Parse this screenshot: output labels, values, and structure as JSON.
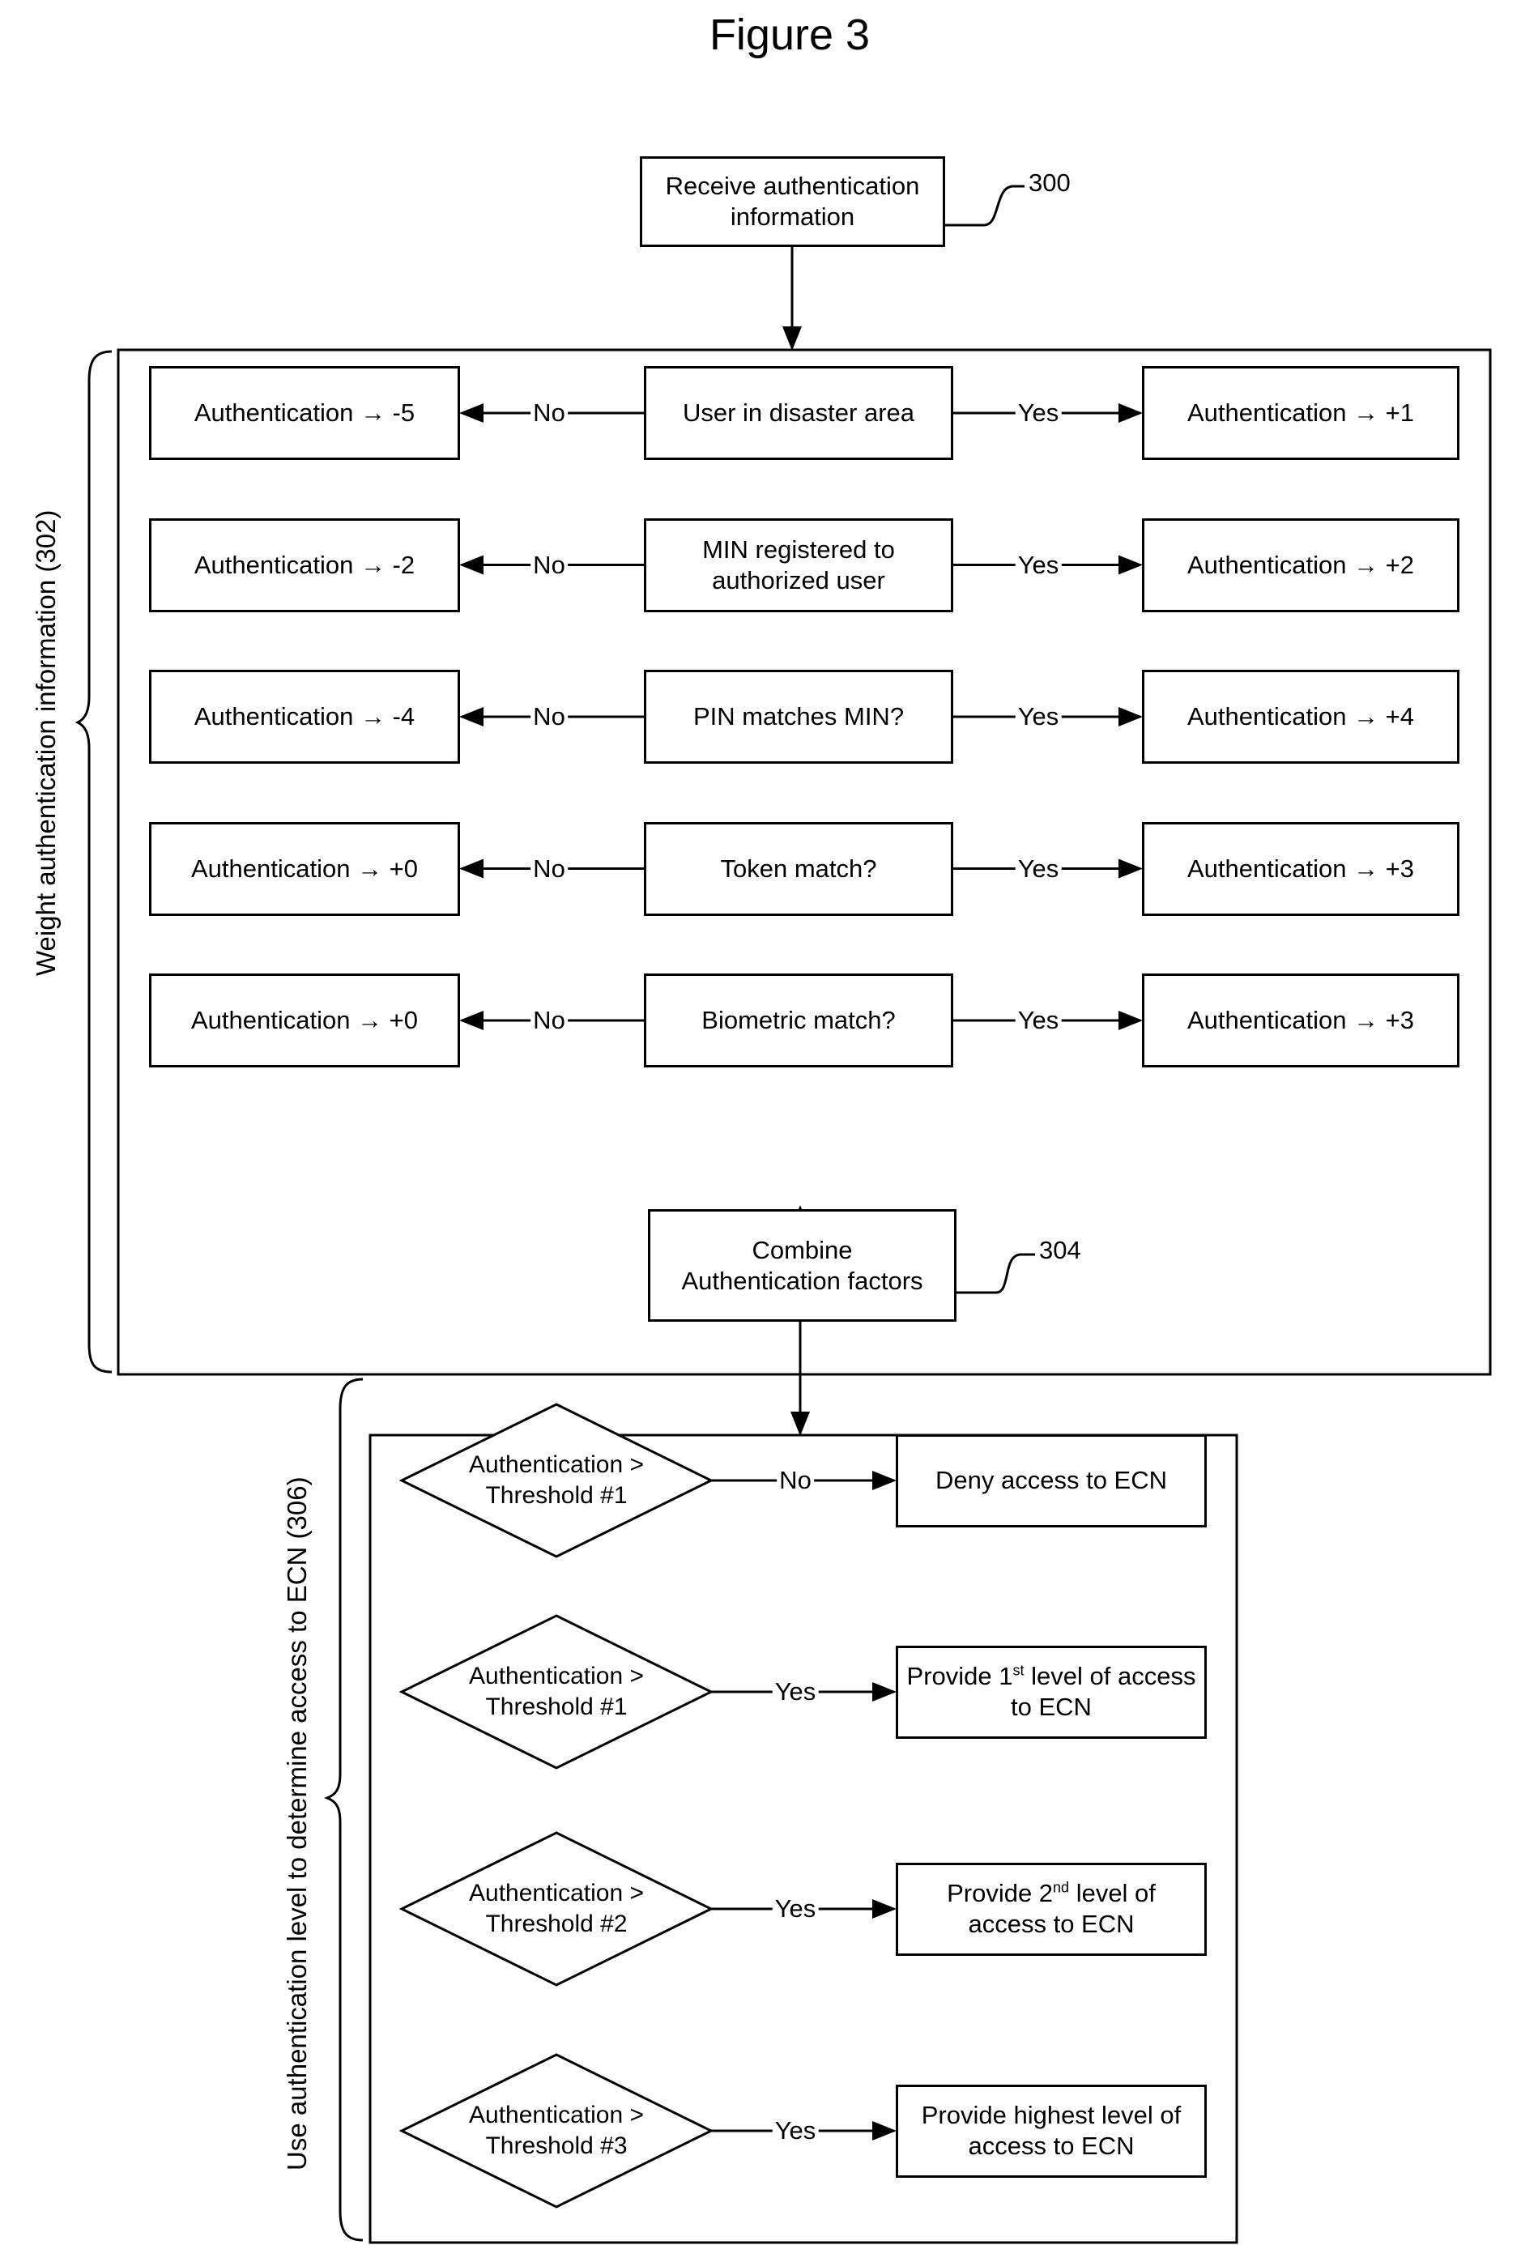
{
  "figure_title": "Figure 3",
  "step_300": {
    "ref": "300",
    "text": "Receive authentication information"
  },
  "section_302": {
    "ref_label": "Weight authentication information (302)",
    "rows": [
      {
        "question": "User in disaster area",
        "no_label": "No",
        "no_result": "Authentication → -5",
        "yes_label": "Yes",
        "yes_result": "Authentication → +1"
      },
      {
        "question": "MIN registered to authorized user",
        "no_label": "No",
        "no_result": "Authentication → -2",
        "yes_label": "Yes",
        "yes_result": "Authentication → +2"
      },
      {
        "question": "PIN matches MIN?",
        "no_label": "No",
        "no_result": "Authentication → -4",
        "yes_label": "Yes",
        "yes_result": "Authentication → +4"
      },
      {
        "question": "Token match?",
        "no_label": "No",
        "no_result": "Authentication → +0",
        "yes_label": "Yes",
        "yes_result": "Authentication → +3"
      },
      {
        "question": "Biometric match?",
        "no_label": "No",
        "no_result": "Authentication → +0",
        "yes_label": "Yes",
        "yes_result": "Authentication → +3"
      }
    ]
  },
  "step_304": {
    "ref": "304",
    "line1": "Combine",
    "line2": "Authentication factors"
  },
  "section_306": {
    "ref_label": "Use authentication level to determine access to ECN (306)",
    "decisions": [
      {
        "condition_line1": "Authentication >",
        "condition_line2": "Threshold #1",
        "branch": "No",
        "result_pre": "Deny access to ECN",
        "result_sup": "",
        "result_post": ""
      },
      {
        "condition_line1": "Authentication >",
        "condition_line2": "Threshold #1",
        "branch": "Yes",
        "result_pre": "Provide 1",
        "result_sup": "st",
        "result_post": " level of access to ECN"
      },
      {
        "condition_line1": "Authentication >",
        "condition_line2": "Threshold #2",
        "branch": "Yes",
        "result_pre": "Provide 2",
        "result_sup": "nd",
        "result_post": " level of access to ECN"
      },
      {
        "condition_line1": "Authentication >",
        "condition_line2": "Threshold #3",
        "branch": "Yes",
        "result_pre": "Provide highest level of access to ECN",
        "result_sup": "",
        "result_post": ""
      }
    ]
  }
}
